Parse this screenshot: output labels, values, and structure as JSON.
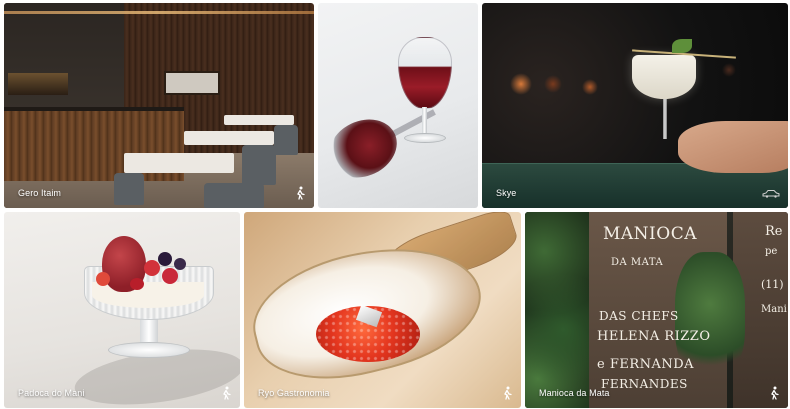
{
  "gallery": {
    "tiles": [
      {
        "name": "Gero Itaim",
        "travel_mode": "walking"
      },
      {
        "name": "",
        "travel_mode": ""
      },
      {
        "name": "Skye",
        "travel_mode": "car"
      },
      {
        "name": "Padoca do Mani",
        "travel_mode": "walking"
      },
      {
        "name": "Ryo Gastronomia",
        "travel_mode": "walking"
      },
      {
        "name": "Manioca da Mata",
        "travel_mode": "walking"
      }
    ]
  },
  "sign": {
    "line1": "MANIOCA",
    "line2": "DA MATA",
    "line3": "DAS CHEFS",
    "line4": "HELENA RIZZO",
    "line5": "e FERNANDA",
    "line6": "FERNANDES",
    "right1": "Re",
    "right2": "pe",
    "right3": "(11)",
    "right4": "Mani"
  },
  "colors": {
    "caption_text": "#ffffff",
    "page_background": "#ffffff"
  },
  "icons": {
    "walking": "person-walking-icon",
    "car": "car-icon"
  }
}
